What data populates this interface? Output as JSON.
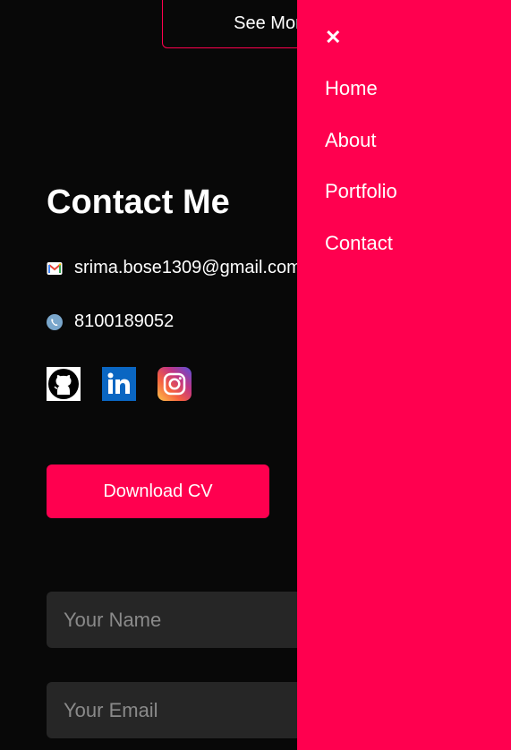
{
  "top": {
    "see_more_label": "See More"
  },
  "contact": {
    "title": "Contact Me",
    "email": "srima.bose1309@gmail.com",
    "phone": "8100189052",
    "email_icon": "gmail-icon",
    "phone_icon": "phone-icon",
    "socials": [
      {
        "name": "github-icon"
      },
      {
        "name": "linkedin-icon"
      },
      {
        "name": "instagram-icon"
      }
    ],
    "download_label": "Download CV"
  },
  "form": {
    "name_placeholder": "Your Name",
    "email_placeholder": "Your Email"
  },
  "menu": {
    "close_glyph": "✕",
    "items": [
      {
        "label": "Home"
      },
      {
        "label": "About"
      },
      {
        "label": "Portfolio"
      },
      {
        "label": "Contact"
      }
    ]
  },
  "colors": {
    "accent": "#ff004f",
    "background": "#080808",
    "field": "#262626"
  }
}
